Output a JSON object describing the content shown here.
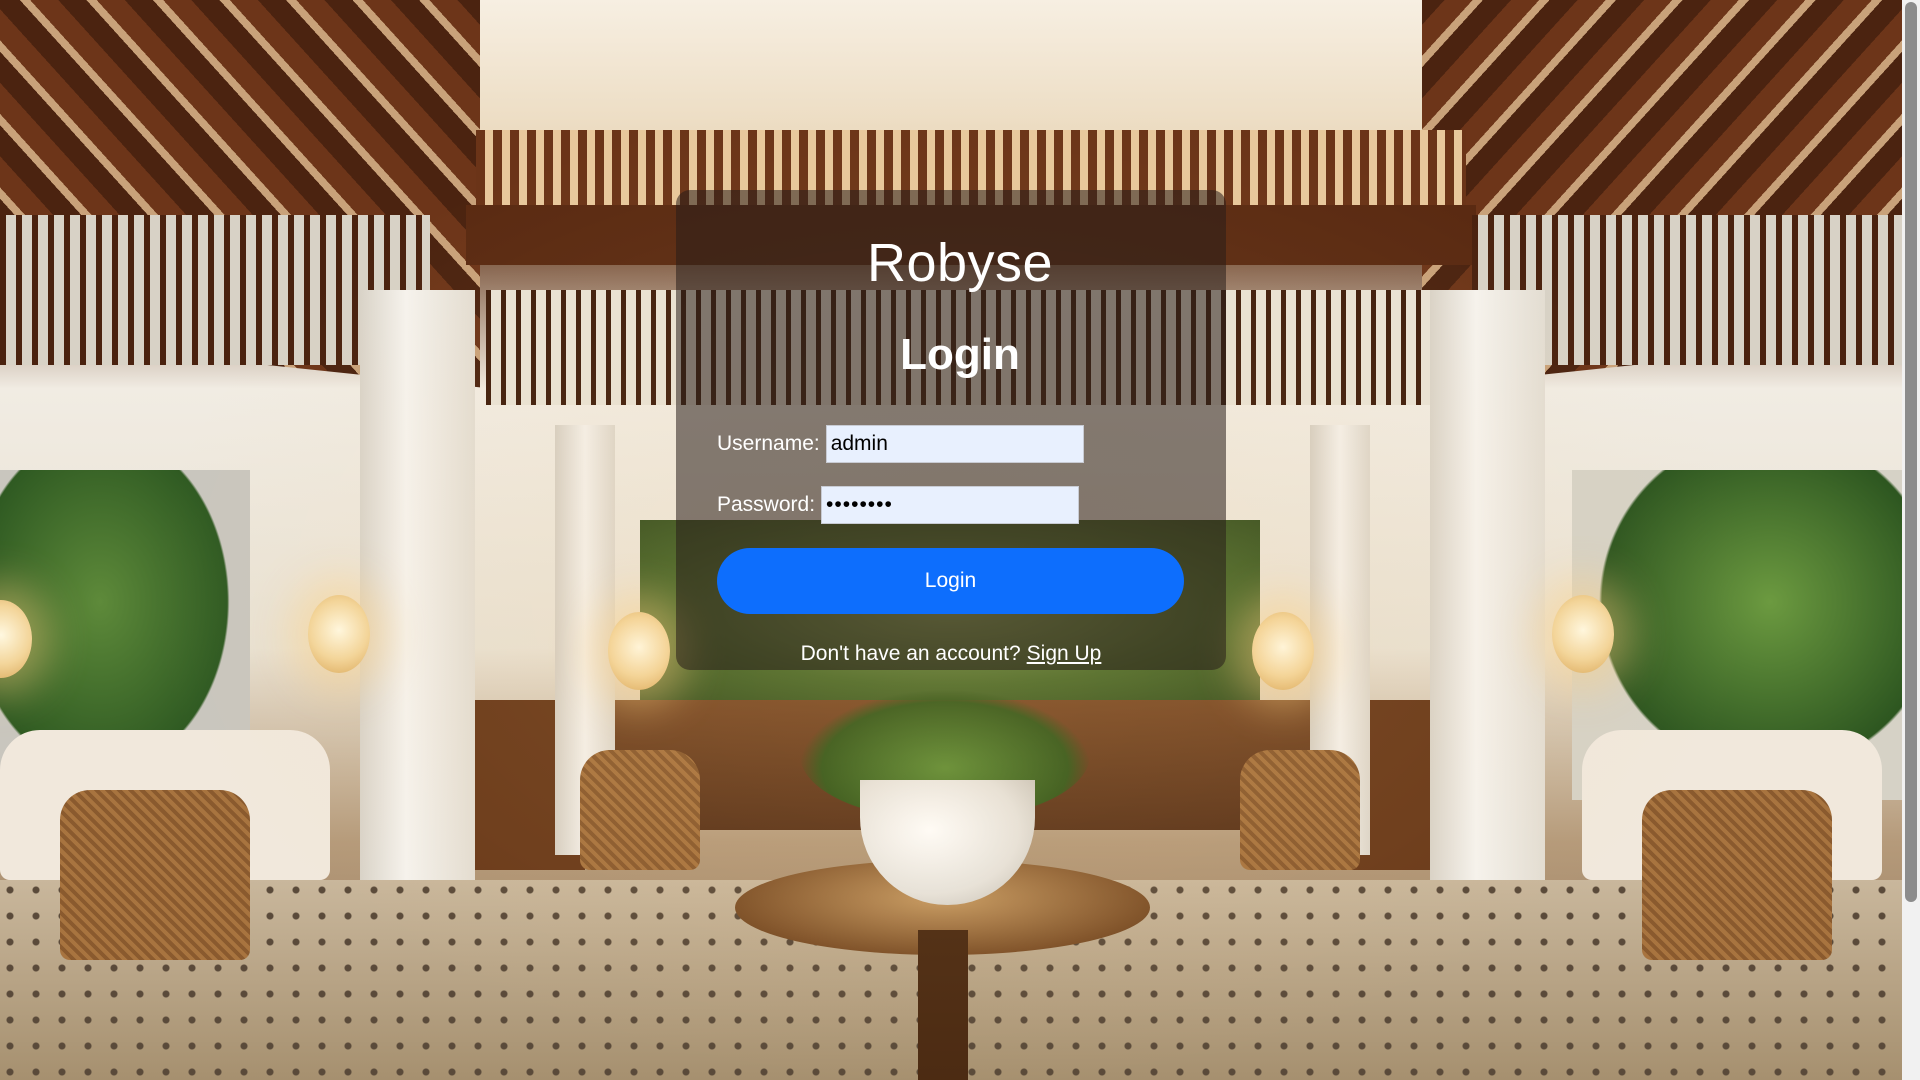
{
  "app": {
    "brand": "Robyse"
  },
  "login_form": {
    "heading": "Login",
    "username_label": "Username:",
    "username_value": "admin",
    "password_label": "Password:",
    "password_value": "password",
    "submit_label": "Login",
    "signup_prompt": "Don't have an account?",
    "signup_link": "Sign Up"
  },
  "colors": {
    "primary_button": "#0d6efd",
    "card_overlay": "rgba(40,30,25,0.55)",
    "input_autofill": "#e8f0fe"
  },
  "background": {
    "icon": "hotel-lobby-photo"
  }
}
